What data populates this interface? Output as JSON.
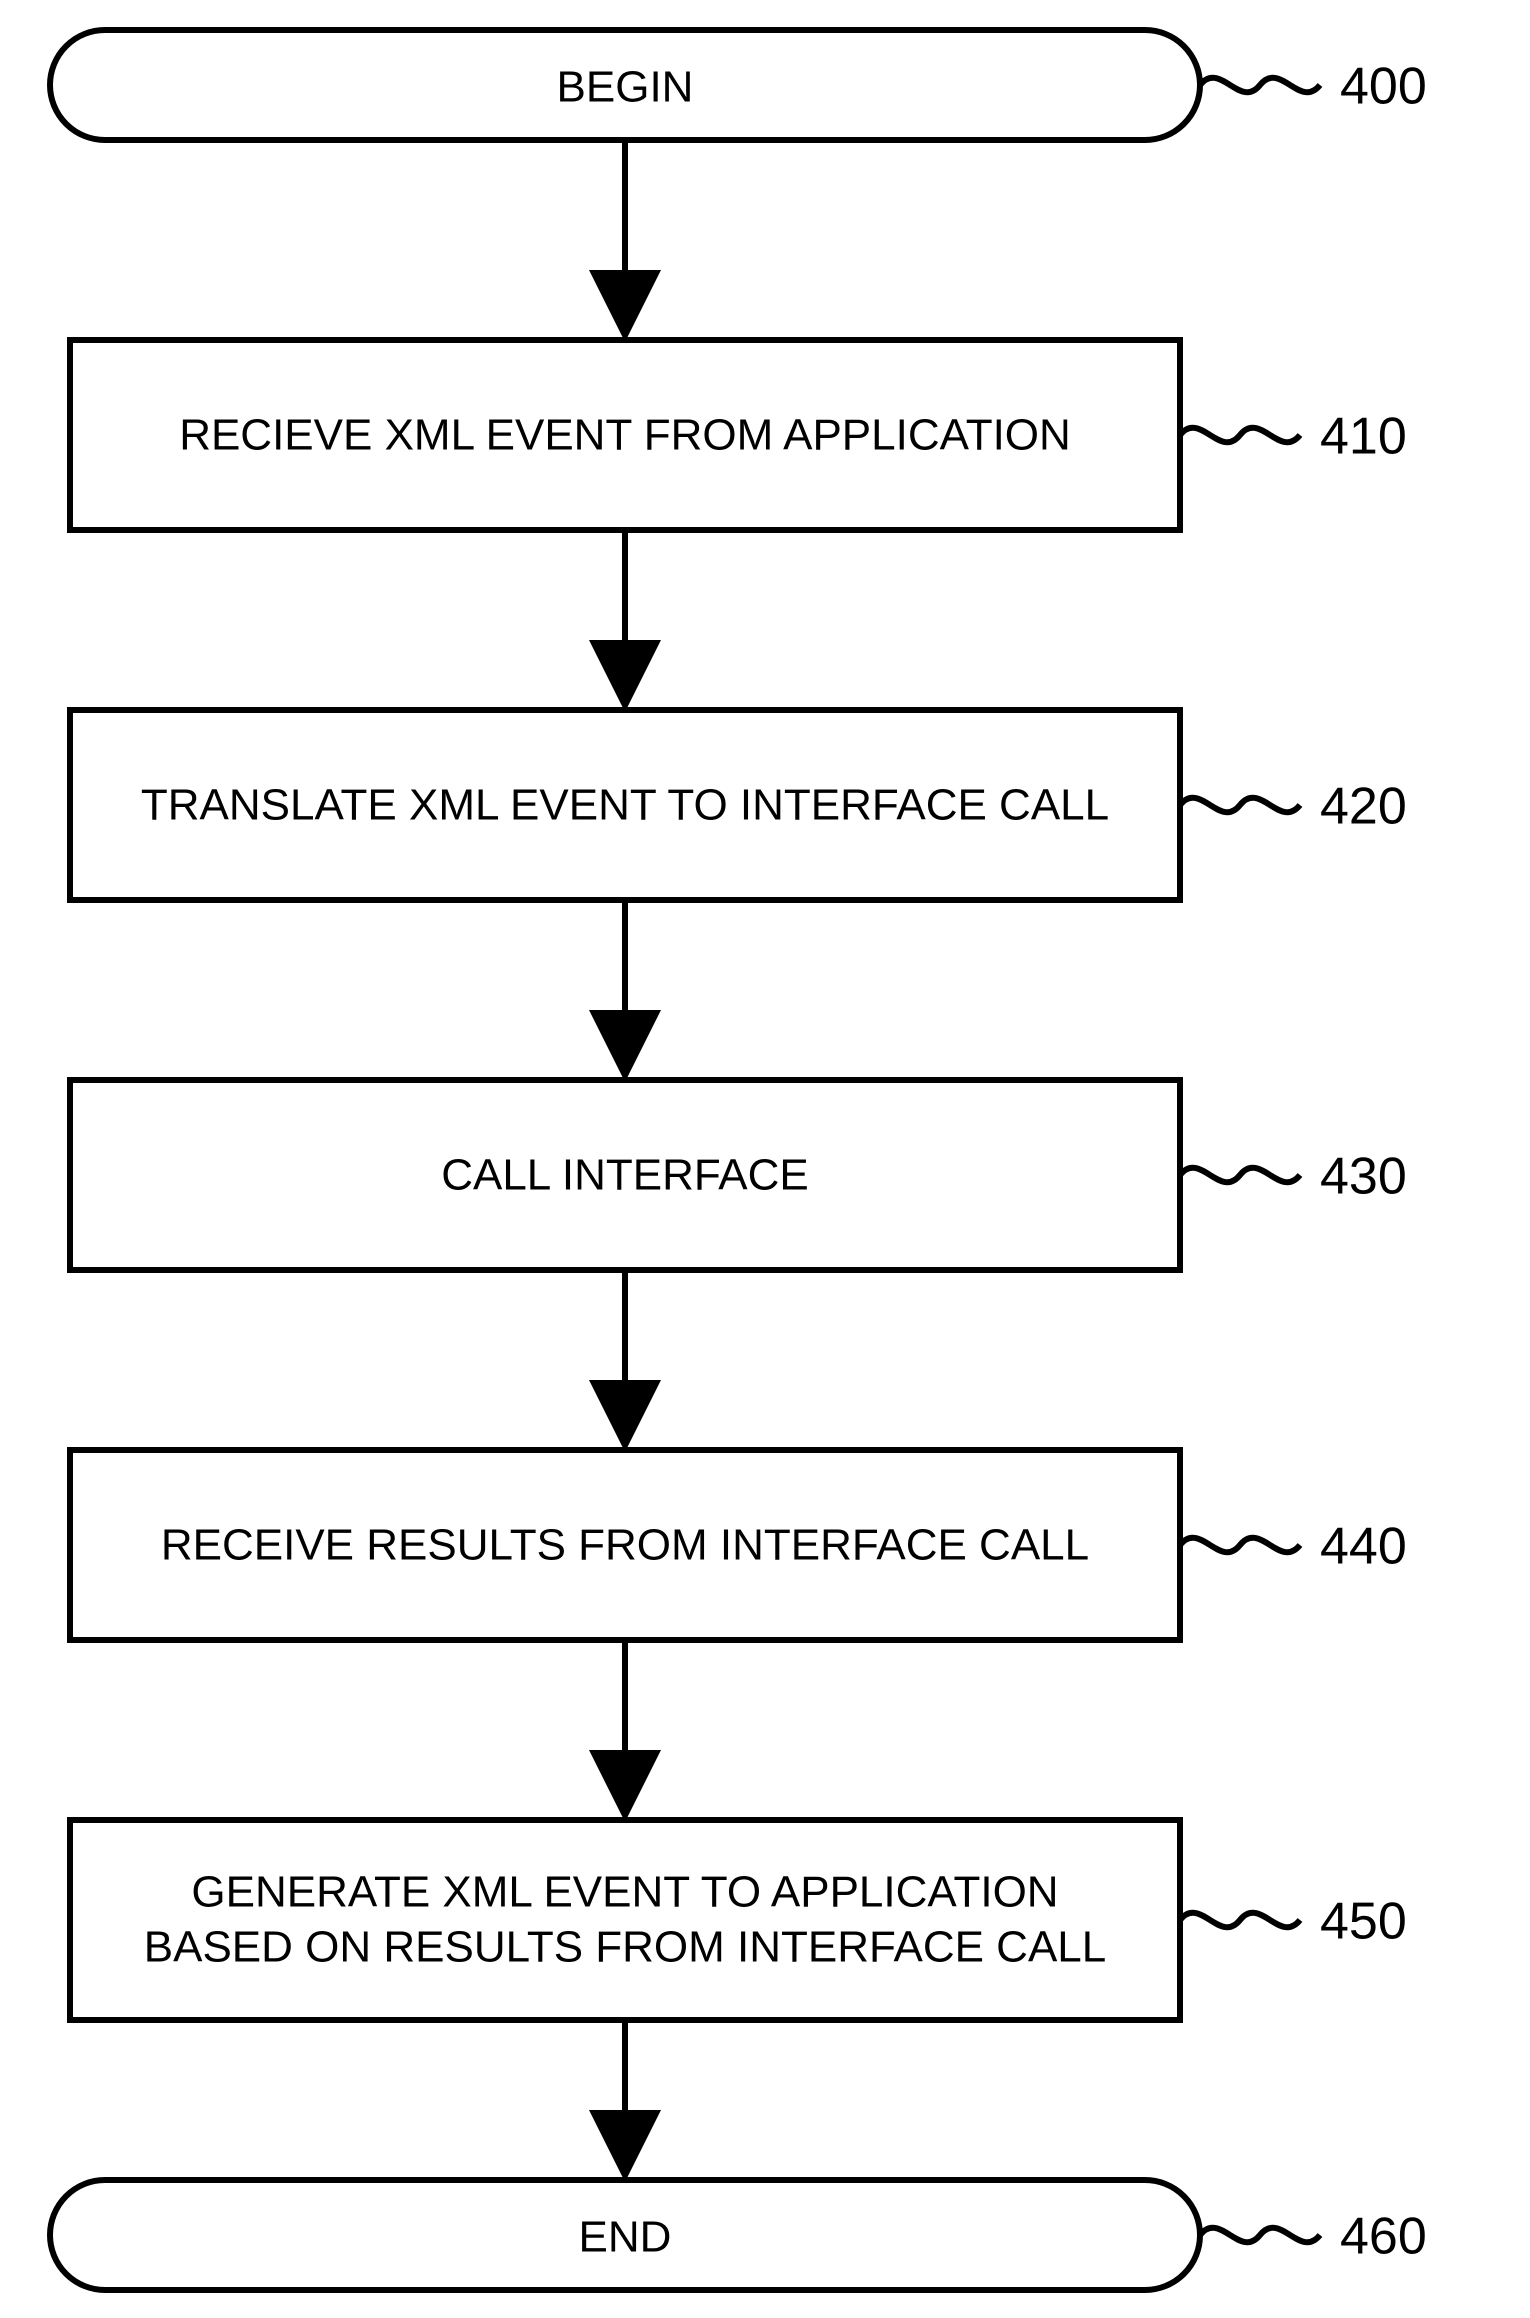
{
  "flow": {
    "begin": {
      "text": "BEGIN",
      "label": "400"
    },
    "step1": {
      "text": "RECIEVE XML EVENT FROM APPLICATION",
      "label": "410"
    },
    "step2": {
      "text": "TRANSLATE XML EVENT TO INTERFACE CALL",
      "label": "420"
    },
    "step3": {
      "text": "CALL  INTERFACE",
      "label": "430"
    },
    "step4": {
      "text": "RECEIVE RESULTS FROM INTERFACE CALL",
      "label": "440"
    },
    "step5": {
      "line1": "GENERATE XML EVENT TO APPLICATION",
      "line2": "BASED ON RESULTS FROM INTERFACE CALL",
      "label": "450"
    },
    "end": {
      "text": "END",
      "label": "460"
    }
  }
}
